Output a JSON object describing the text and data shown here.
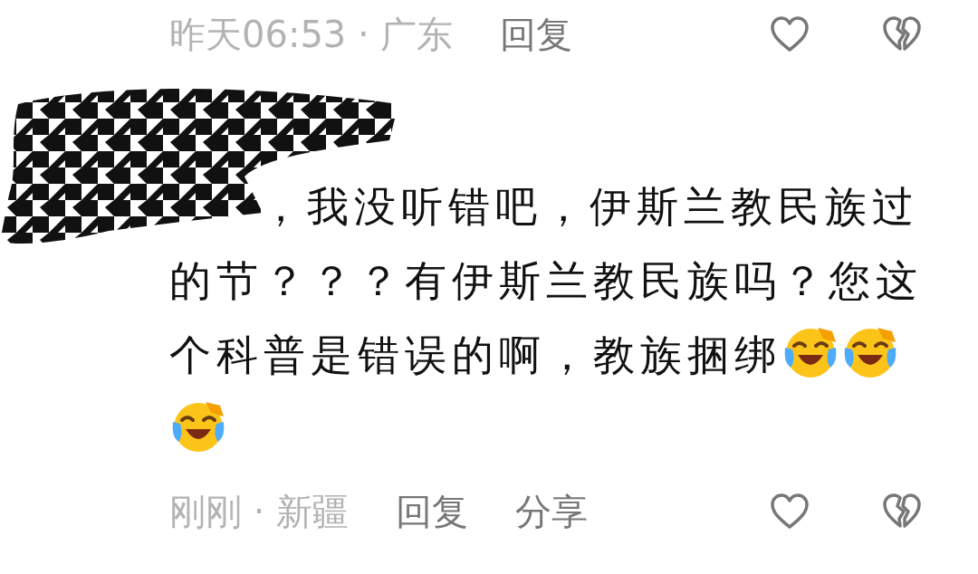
{
  "previous_comment": {
    "meta": "昨天06:53 · 广东",
    "actions": [
      "回复"
    ]
  },
  "comment": {
    "body": [
      {
        "kind": "redaction"
      },
      {
        "kind": "text",
        "text": "，我没听错吧，伊斯兰教民族过"
      },
      {
        "kind": "text",
        "text": "的节？？？有伊斯兰教民族吗？您这"
      },
      {
        "kind": "text",
        "text": "个科普是错误的啊，教族捆绑"
      },
      {
        "kind": "emoji"
      },
      {
        "kind": "emoji"
      },
      {
        "kind": "emoji"
      }
    ],
    "meta": "刚刚 · 新疆",
    "actions": [
      "回复",
      "分享"
    ]
  }
}
